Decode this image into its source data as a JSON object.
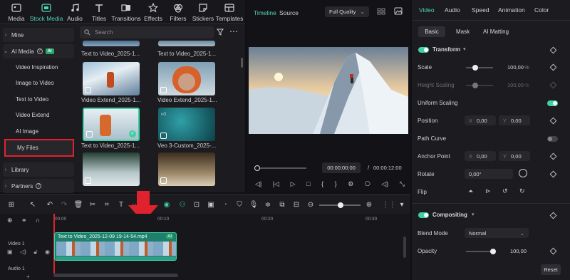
{
  "top_tabs": [
    {
      "label": "Media",
      "icon": "media-icon"
    },
    {
      "label": "Stock Media",
      "icon": "stock-media-icon",
      "active": true
    },
    {
      "label": "Audio",
      "icon": "audio-icon"
    },
    {
      "label": "Titles",
      "icon": "titles-icon"
    },
    {
      "label": "Transitions",
      "icon": "transitions-icon"
    },
    {
      "label": "Effects",
      "icon": "effects-icon"
    },
    {
      "label": "Filters",
      "icon": "filters-icon"
    },
    {
      "label": "Stickers",
      "icon": "stickers-icon"
    },
    {
      "label": "Templates",
      "icon": "templates-icon"
    }
  ],
  "sidebar": {
    "mine": "Mine",
    "ai_media": "AI Media",
    "ai_badge": "AI",
    "items": [
      "Video Inspiration",
      "Image to Video",
      "Text to Video",
      "Video Extend",
      "AI Image",
      "My Files"
    ],
    "library": "Library",
    "partners": "Partners",
    "selected": "My Files"
  },
  "media": {
    "search_placeholder": "Search",
    "top_labels": [
      "Text to Video_2025-1...",
      "Text to Video_2025-1..."
    ],
    "items": [
      {
        "label": "Video Extend_2025-1..."
      },
      {
        "label": "Video Extend_2025-1..."
      },
      {
        "label": "Text to Video_2025-1..."
      },
      {
        "label": "Veo 3-Custom_2025-..."
      }
    ]
  },
  "preview": {
    "tabs": [
      "Timeline",
      "Source"
    ],
    "active_tab": "Timeline",
    "quality": "Full Quality",
    "current_time": "00:00:00:00",
    "separator": "/",
    "total_time": "00:00:12:00"
  },
  "inspector": {
    "tabs": [
      "Video",
      "Audio",
      "Speed",
      "Animation",
      "Color"
    ],
    "active_tab": "Video",
    "subtabs": [
      "Basic",
      "Mask",
      "AI Matting"
    ],
    "active_subtab": "Basic",
    "transform": "Transform",
    "scale_label": "Scale",
    "scale_value": "100,00",
    "scale_unit": "%",
    "height_label": "Height Scaling",
    "height_value": "100,00",
    "height_unit": "%",
    "uniform_label": "Uniform Scaling",
    "position_label": "Position",
    "pos_x": "0,00",
    "pos_y": "0,00",
    "x": "X",
    "y": "Y",
    "path_label": "Path Curve",
    "anchor_label": "Anchor Point",
    "anchor_x": "0,00",
    "anchor_y": "0,00",
    "rotate_label": "Rotate",
    "rotate_value": "0,00°",
    "flip_label": "Flip",
    "compositing": "Compositing",
    "blend_label": "Blend Mode",
    "blend_value": "Normal",
    "opacity_label": "Opacity",
    "opacity_value": "100,00",
    "reset": "Reset"
  },
  "timeline": {
    "ticks": [
      "00:00",
      "00:10",
      "00:20",
      "00:30"
    ],
    "clip_label": "Text to Video_2025-12-09 19-14-54.mp4",
    "clip_badge": "AI",
    "video_track": "Video 1",
    "audio_track": "Audio 1"
  },
  "colors": {
    "accent": "#3fd0a6",
    "highlight_box": "#e0222f",
    "arrow": "#e0222f"
  }
}
